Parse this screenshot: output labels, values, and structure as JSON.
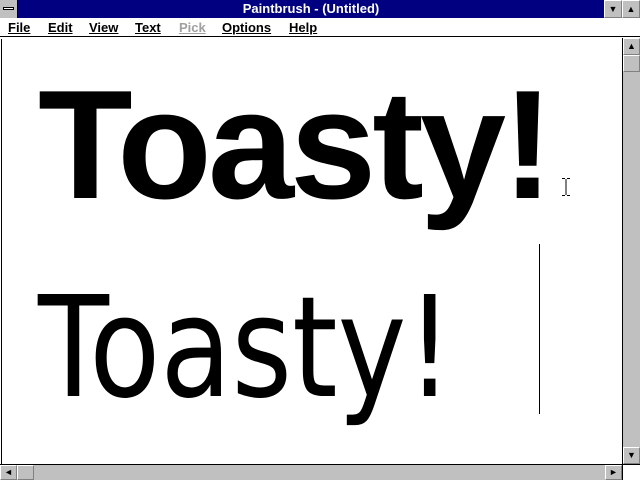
{
  "window": {
    "title": "Paintbrush - (Untitled)"
  },
  "titlebar": {
    "minimize_icon": "▼",
    "maximize_icon": "▲"
  },
  "menu": [
    {
      "label": "File",
      "disabled": false
    },
    {
      "label": "Edit",
      "disabled": false
    },
    {
      "label": "View",
      "disabled": false
    },
    {
      "label": "Text",
      "disabled": false
    },
    {
      "label": "Pick",
      "disabled": true
    },
    {
      "label": "Options",
      "disabled": false
    },
    {
      "label": "Help",
      "disabled": false
    }
  ],
  "canvas": {
    "text_large": "Toasty!",
    "text_small": "Toasty!"
  },
  "scrollbars": {
    "up_arrow": "▲",
    "down_arrow": "▼",
    "left_arrow": "◄",
    "right_arrow": "►"
  },
  "colors": {
    "titlebar": "#000080",
    "chrome": "#c0c0c0",
    "disabled_text": "#a0a0a0"
  }
}
